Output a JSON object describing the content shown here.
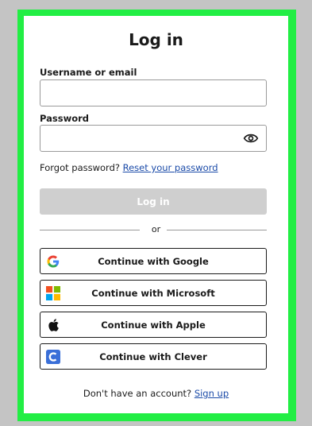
{
  "title": "Log in",
  "username": {
    "label": "Username or email",
    "value": ""
  },
  "password": {
    "label": "Password",
    "value": ""
  },
  "forgot": {
    "text": "Forgot password?",
    "link": "Reset your password"
  },
  "login_button": "Log in",
  "divider_text": "or",
  "sso": [
    {
      "label": "Continue with Google",
      "icon": "google-icon"
    },
    {
      "label": "Continue with Microsoft",
      "icon": "microsoft-icon"
    },
    {
      "label": "Continue with Apple",
      "icon": "apple-icon"
    },
    {
      "label": "Continue with Clever",
      "icon": "clever-icon"
    }
  ],
  "signup": {
    "text": "Don't have an account?",
    "link": "Sign up"
  },
  "colors": {
    "frame": "#22ee44",
    "link": "#1a4aa8",
    "disabled_button": "#cfcfcf",
    "clever": "#3a6fd8"
  }
}
